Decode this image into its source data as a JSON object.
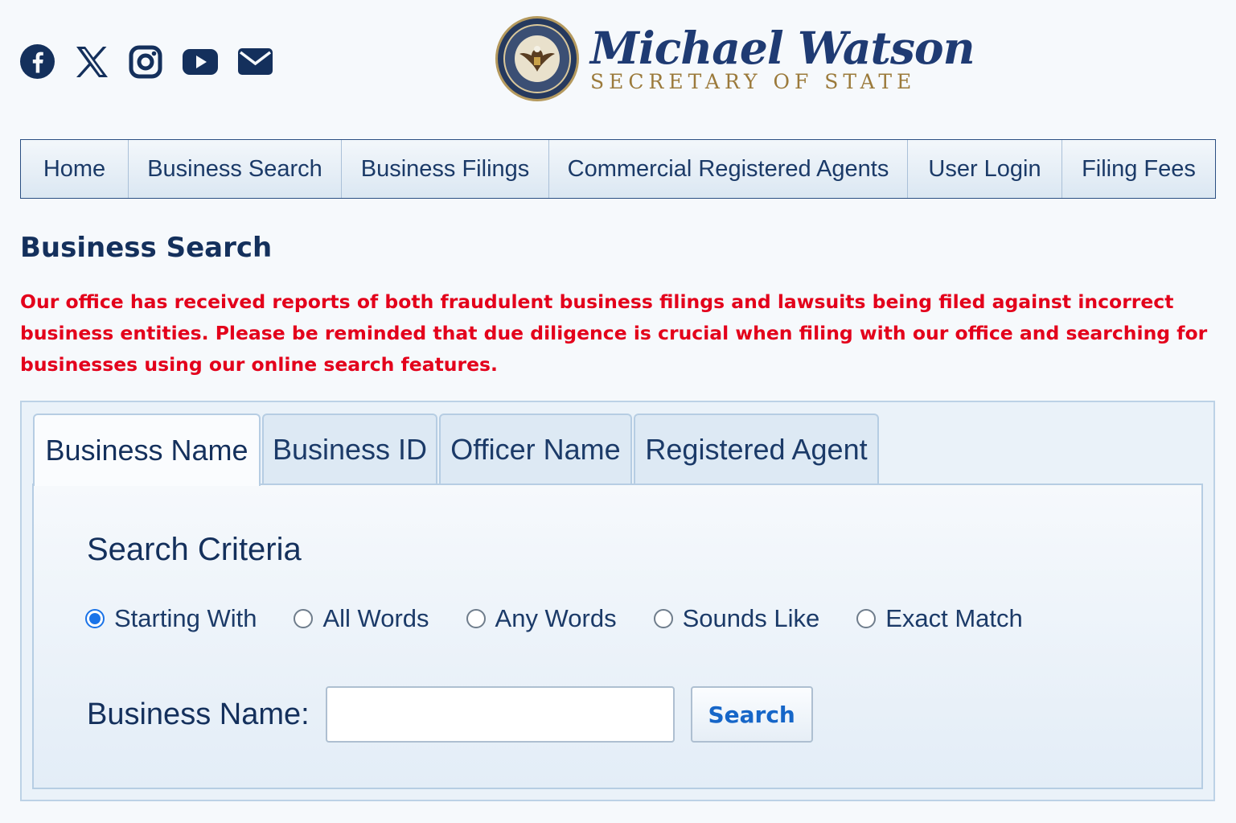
{
  "header": {
    "social_icons": [
      "facebook-icon",
      "x-icon",
      "instagram-icon",
      "youtube-icon",
      "email-icon"
    ],
    "logo": {
      "name": "Michael Watson",
      "title": "SECRETARY OF STATE"
    }
  },
  "nav": {
    "items": [
      {
        "label": "Home"
      },
      {
        "label": "Business Search"
      },
      {
        "label": "Business Filings"
      },
      {
        "label": "Commercial Registered Agents"
      },
      {
        "label": "User Login"
      },
      {
        "label": "Filing Fees"
      }
    ]
  },
  "main": {
    "title": "Business Search",
    "warning": "Our office has received reports of both fraudulent business filings and lawsuits being filed against incorrect business entities. Please be reminded that due diligence is crucial when filing with our office and searching for businesses using our online search features.",
    "tabs": [
      {
        "label": "Business Name",
        "active": true
      },
      {
        "label": "Business ID",
        "active": false
      },
      {
        "label": "Officer Name",
        "active": false
      },
      {
        "label": "Registered Agent",
        "active": false
      }
    ],
    "criteria_title": "Search Criteria",
    "criteria_options": [
      {
        "label": "Starting With",
        "checked": true
      },
      {
        "label": "All Words",
        "checked": false
      },
      {
        "label": "Any Words",
        "checked": false
      },
      {
        "label": "Sounds Like",
        "checked": false
      },
      {
        "label": "Exact Match",
        "checked": false
      }
    ],
    "field_label": "Business Name:",
    "field_value": "",
    "search_label": "Search"
  },
  "colors": {
    "navy": "#14305c",
    "warning_red": "#e3001b",
    "gold": "#9b7a3b",
    "link_blue": "#1666c8"
  }
}
